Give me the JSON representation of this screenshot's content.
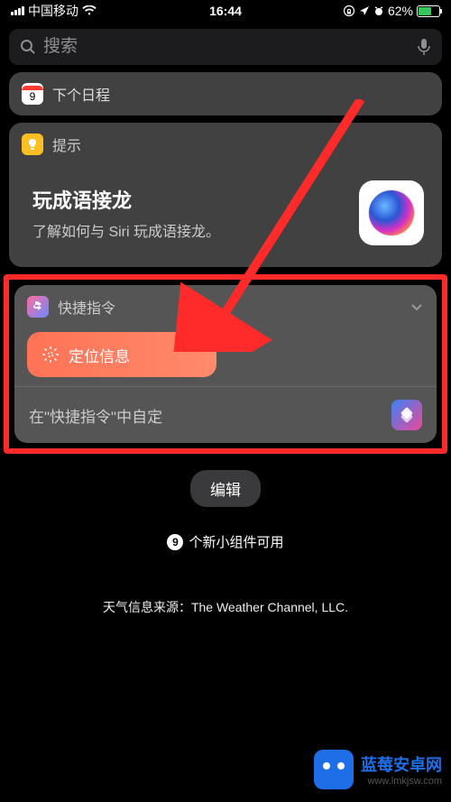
{
  "status": {
    "carrier": "中国移动",
    "time": "16:44",
    "battery_pct": "62%"
  },
  "search": {
    "placeholder": "搜索"
  },
  "widgets": {
    "calendar": {
      "title": "下个日程",
      "day": "9"
    },
    "tips": {
      "label": "提示",
      "title": "玩成语接龙",
      "subtitle": "了解如何与 Siri 玩成语接龙。"
    },
    "shortcuts": {
      "label": "快捷指令",
      "chip": "定位信息",
      "customize": "在\"快捷指令\"中自定"
    }
  },
  "buttons": {
    "edit": "编辑"
  },
  "footer": {
    "widgets_count": "9",
    "widgets_text": "个新小组件可用",
    "weather_src": "天气信息来源：The Weather Channel, LLC."
  },
  "watermark": {
    "title": "蓝莓安卓网",
    "url": "www.lmkjsw.com"
  }
}
